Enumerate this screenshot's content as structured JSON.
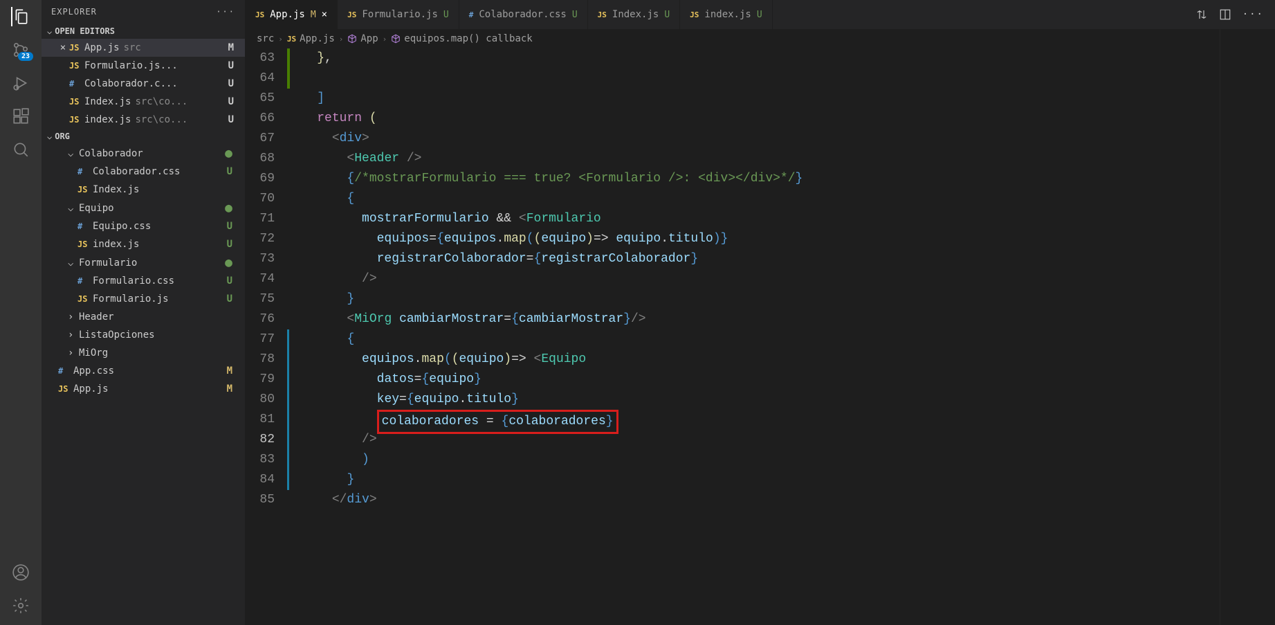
{
  "sidebar_title": "EXPLORER",
  "sections": {
    "open_editors": "OPEN EDITORS",
    "project": "ORG"
  },
  "scm_badge": "23",
  "open_editors": [
    {
      "icon": "JS",
      "icon_class": "js-icon",
      "name": "App.js",
      "path": "src",
      "status": "M",
      "status_class": "status-m",
      "active": true,
      "close": "×"
    },
    {
      "icon": "JS",
      "icon_class": "js-icon",
      "name": "Formulario.js...",
      "path": "",
      "status": "U",
      "status_class": "status-u"
    },
    {
      "icon": "#",
      "icon_class": "css-icon",
      "name": "Colaborador.c...",
      "path": "",
      "status": "U",
      "status_class": "status-u"
    },
    {
      "icon": "JS",
      "icon_class": "js-icon",
      "name": "Index.js",
      "path": "src\\co...",
      "status": "U",
      "status_class": "status-u"
    },
    {
      "icon": "JS",
      "icon_class": "js-icon",
      "name": "index.js",
      "path": "src\\co...",
      "status": "U",
      "status_class": "status-u"
    }
  ],
  "tree": [
    {
      "indent": 30,
      "chev": "⌵",
      "name": "Colaborador",
      "status": "●",
      "status_class": "status-dot"
    },
    {
      "indent": 44,
      "icon": "#",
      "icon_class": "css-icon",
      "name": "Colaborador.css",
      "status": "U",
      "status_class": "status-u"
    },
    {
      "indent": 44,
      "icon": "JS",
      "icon_class": "js-icon",
      "name": "Index.js",
      "status": "",
      "status_class": ""
    },
    {
      "indent": 30,
      "chev": "⌵",
      "name": "Equipo",
      "status": "●",
      "status_class": "status-dot"
    },
    {
      "indent": 44,
      "icon": "#",
      "icon_class": "css-icon",
      "name": "Equipo.css",
      "status": "U",
      "status_class": "status-u"
    },
    {
      "indent": 44,
      "icon": "JS",
      "icon_class": "js-icon",
      "name": "index.js",
      "status": "U",
      "status_class": "status-u"
    },
    {
      "indent": 30,
      "chev": "⌵",
      "name": "Formulario",
      "status": "●",
      "status_class": "status-dot"
    },
    {
      "indent": 44,
      "icon": "#",
      "icon_class": "css-icon",
      "name": "Formulario.css",
      "status": "U",
      "status_class": "status-u"
    },
    {
      "indent": 44,
      "icon": "JS",
      "icon_class": "js-icon",
      "name": "Formulario.js",
      "status": "U",
      "status_class": "status-u"
    },
    {
      "indent": 30,
      "chev": "›",
      "name": "Header",
      "status": "",
      "status_class": ""
    },
    {
      "indent": 30,
      "chev": "›",
      "name": "ListaOpciones",
      "status": "",
      "status_class": ""
    },
    {
      "indent": 30,
      "chev": "›",
      "name": "MiOrg",
      "status": "",
      "status_class": ""
    },
    {
      "indent": 16,
      "icon": "#",
      "icon_class": "css-icon",
      "name": "App.css",
      "status": "M",
      "status_class": "status-m"
    },
    {
      "indent": 16,
      "icon": "JS",
      "icon_class": "js-icon",
      "name": "App.js",
      "status": "M",
      "status_class": "status-m"
    }
  ],
  "tabs": [
    {
      "icon": "JS",
      "icon_class": "js-icon",
      "name": "App.js",
      "status": "M",
      "status_class": "status-m",
      "close": "×",
      "active": true
    },
    {
      "icon": "JS",
      "icon_class": "js-icon",
      "name": "Formulario.js",
      "status": "U",
      "status_class": "status-u"
    },
    {
      "icon": "#",
      "icon_class": "css-icon",
      "name": "Colaborador.css",
      "status": "U",
      "status_class": "status-u"
    },
    {
      "icon": "JS",
      "icon_class": "js-icon",
      "name": "Index.js",
      "status": "U",
      "status_class": "status-u"
    },
    {
      "icon": "JS",
      "icon_class": "js-icon",
      "name": "index.js",
      "status": "U",
      "status_class": "status-u"
    }
  ],
  "breadcrumb": [
    {
      "label": "src"
    },
    {
      "icon": "JS",
      "icon_class": "js-icon",
      "label": "App.js"
    },
    {
      "icon_svg": "cube",
      "label": "App"
    },
    {
      "icon_svg": "cube",
      "label": "equipos.map() callback"
    }
  ],
  "line_numbers": [
    "63",
    "64",
    "65",
    "66",
    "67",
    "68",
    "69",
    "70",
    "71",
    "72",
    "73",
    "74",
    "75",
    "76",
    "77",
    "78",
    "79",
    "80",
    "81",
    "82",
    "83",
    "84",
    "85"
  ],
  "current_line": "82",
  "code": {
    "l63": "    },",
    "l65": "  ]",
    "l66_return": "  return",
    "l66_paren": " (",
    "l67_div": "    <div>",
    "l68_header": "      <Header />",
    "l69_comment": "      {/*mostrarFormulario === true? <Formulario />: <div></div>*/}",
    "l70_brace": "      {",
    "l71": "        mostrarFormulario && <Formulario",
    "l72": "          equipos={equipos.map((equipo)=> equipo.titulo)}",
    "l73": "          registrarColaborador={registrarColaborador}",
    "l74": "        />",
    "l75_brace": "      }",
    "l76": "      <MiOrg cambiarMostrar={cambiarMostrar}/>",
    "l77_brace": "      {",
    "l78": "        equipos.map((equipo)=> <Equipo",
    "l79": "          datos={equipo}",
    "l80": "          key={equipo.titulo}",
    "l81_prefix": "          ",
    "l81_highlight": "colaboradores = {colaboradores}",
    "l82": "        />",
    "l83": "        )",
    "l84_brace": "      }",
    "l85_div": "    </div>"
  }
}
